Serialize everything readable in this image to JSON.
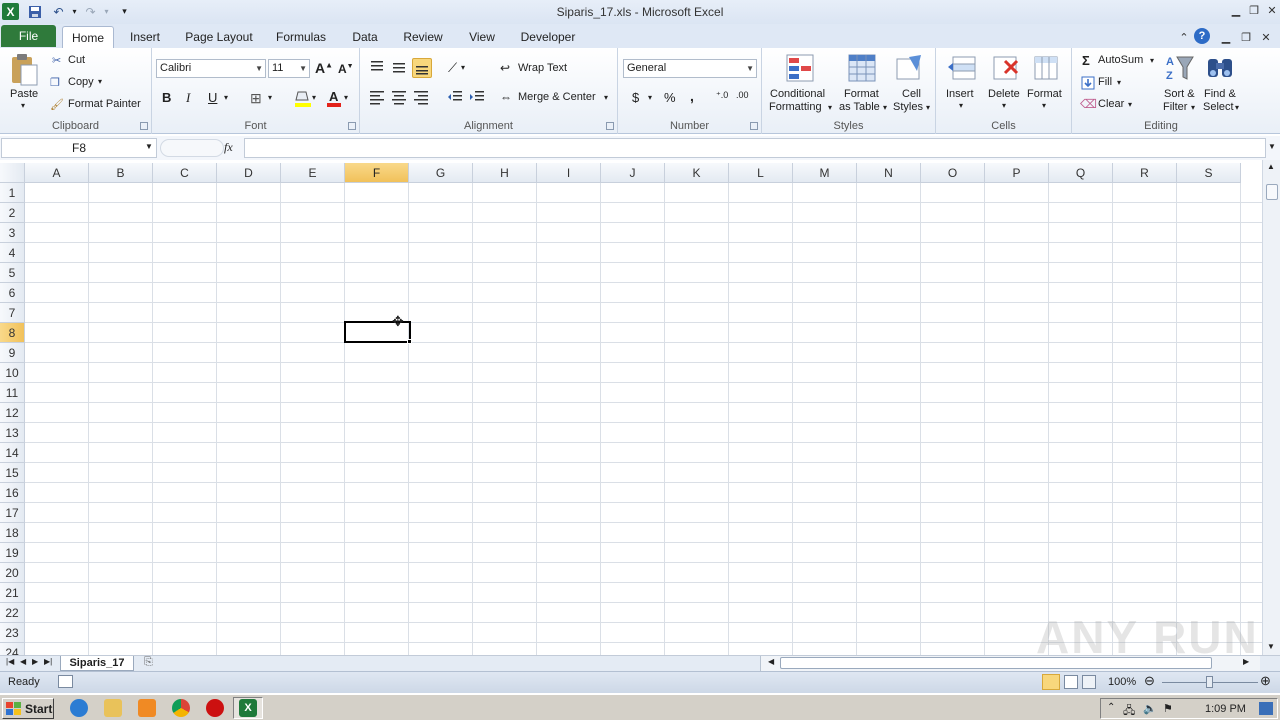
{
  "window": {
    "title": "Siparis_17.xls - Microsoft Excel"
  },
  "tabs": [
    "File",
    "Home",
    "Insert",
    "Page Layout",
    "Formulas",
    "Data",
    "Review",
    "View",
    "Developer"
  ],
  "ribbon": {
    "clipboard": {
      "label": "Clipboard",
      "paste": "Paste",
      "cut": "Cut",
      "copy": "Copy",
      "format_painter": "Format Painter"
    },
    "font": {
      "label": "Font",
      "font_name": "Calibri",
      "font_size": "11",
      "bold": "B",
      "italic": "I",
      "underline": "U"
    },
    "alignment": {
      "label": "Alignment",
      "wrap_text": "Wrap Text",
      "merge_center": "Merge & Center"
    },
    "number": {
      "label": "Number",
      "format": "General",
      "currency": "$",
      "percent": "%",
      "comma": ","
    },
    "styles": {
      "label": "Styles",
      "conditional_1": "Conditional",
      "conditional_2": "Formatting",
      "format_table_1": "Format",
      "format_table_2": "as Table",
      "cell_styles_1": "Cell",
      "cell_styles_2": "Styles"
    },
    "cells": {
      "label": "Cells",
      "insert": "Insert",
      "delete": "Delete",
      "format": "Format"
    },
    "editing": {
      "label": "Editing",
      "autosum": "AutoSum",
      "fill": "Fill",
      "clear": "Clear",
      "sort_1": "Sort &",
      "sort_2": "Filter",
      "find_1": "Find &",
      "find_2": "Select"
    }
  },
  "formula_bar": {
    "name_box": "F8",
    "fx": "fx",
    "value": ""
  },
  "grid": {
    "columns": [
      "A",
      "B",
      "C",
      "D",
      "E",
      "F",
      "G",
      "H",
      "I",
      "J",
      "K",
      "L",
      "M",
      "N",
      "O",
      "P",
      "Q",
      "R",
      "S"
    ],
    "rows": [
      "1",
      "2",
      "3",
      "4",
      "5",
      "6",
      "7",
      "8",
      "9",
      "10",
      "11",
      "12",
      "13",
      "14",
      "15",
      "16",
      "17",
      "18",
      "19",
      "20",
      "21",
      "22",
      "23",
      "24"
    ],
    "active_column": "F",
    "active_row": "8"
  },
  "sheet_tabs": [
    "Siparis_17"
  ],
  "status": {
    "ready": "Ready",
    "zoom": "100%"
  },
  "taskbar": {
    "start": "Start",
    "time": "1:09 PM"
  },
  "watermark": "ANY RUN"
}
